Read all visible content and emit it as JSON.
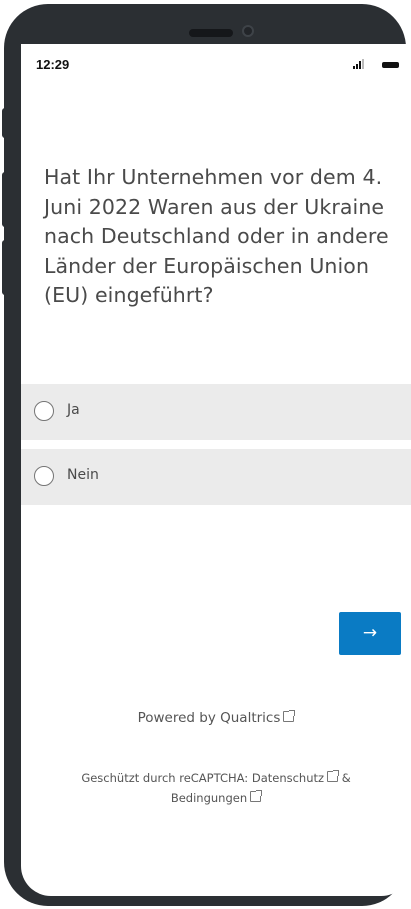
{
  "status": {
    "time": "12:29"
  },
  "question": {
    "text": "Hat Ihr Unternehmen vor dem 4. Juni 2022 Waren aus der Ukraine nach Deutschland oder in andere Länder der Europäischen Union (EU) eingeführt?"
  },
  "choices": [
    {
      "label": "Ja",
      "selected": false
    },
    {
      "label": "Nein",
      "selected": false
    }
  ],
  "navigation": {
    "next_label": "→"
  },
  "footer": {
    "powered_by": "Powered by Qualtrics",
    "recaptcha_prefix": "Geschützt durch reCAPTCHA: ",
    "privacy_label": "Datenschutz",
    "amp": "&",
    "terms_label": "Bedingungen"
  },
  "icons": {
    "radio": "radio-unchecked-icon",
    "external": "external-link-icon",
    "signal": "signal-icon",
    "battery": "battery-icon"
  },
  "colors": {
    "accent": "#0a7bc4",
    "choice_bg": "#ebebeb",
    "frame": "#2b2f33"
  }
}
